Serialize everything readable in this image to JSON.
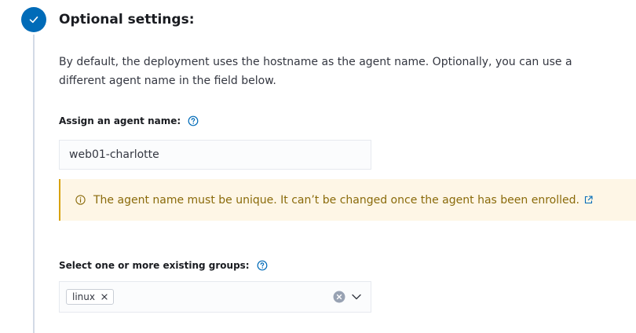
{
  "step": {
    "title": "Optional settings:",
    "status": "complete",
    "accent_color": "#006bb8"
  },
  "description": "By default, the deployment uses the hostname as the agent name. Optionally, you can use a different agent name in the field below.",
  "agent_name": {
    "label": "Assign an agent name:",
    "help_icon": "question-circle-icon",
    "value": "web01-charlotte"
  },
  "callout": {
    "icon": "info-circle-icon",
    "text": "The agent name must be unique. It can’t be changed once the agent has been enrolled.",
    "link_icon": "external-link-icon",
    "color": "#8a6a0a",
    "background": "#fef6e6"
  },
  "groups": {
    "label": "Select one or more existing groups:",
    "help_icon": "question-circle-icon",
    "selected": [
      "linux"
    ],
    "clear_icon": "clear-icon",
    "dropdown_icon": "chevron-down-icon"
  }
}
